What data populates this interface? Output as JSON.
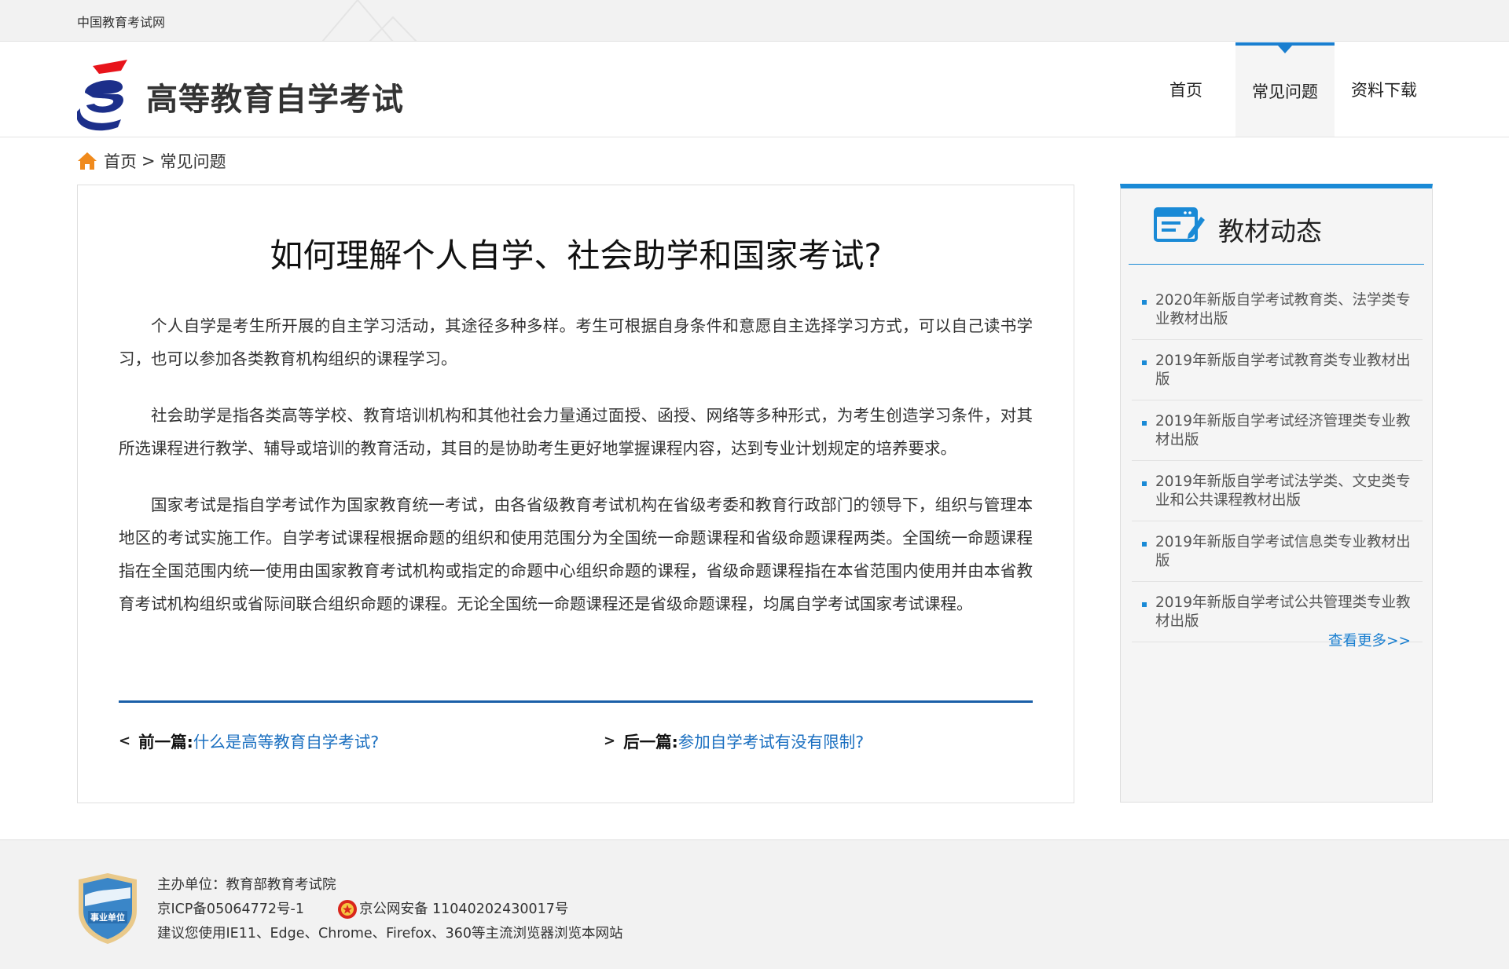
{
  "topbar": {
    "site_name": "中国教育考试网"
  },
  "header": {
    "title": "高等教育自学考试",
    "nav": [
      {
        "label": "首页",
        "active": false
      },
      {
        "label": "常见问题",
        "active": true
      },
      {
        "label": "资料下载",
        "active": false
      }
    ]
  },
  "breadcrumb": {
    "home": "首页",
    "separator": ">",
    "current": "常见问题"
  },
  "article": {
    "title": "如何理解个人自学、社会助学和国家考试?",
    "paragraphs": [
      "个人自学是考生所开展的自主学习活动，其途径多种多样。考生可根据自身条件和意愿自主选择学习方式，可以自己读书学习，也可以参加各类教育机构组织的课程学习。",
      "社会助学是指各类高等学校、教育培训机构和其他社会力量通过面授、函授、网络等多种形式，为考生创造学习条件，对其所选课程进行教学、辅导或培训的教育活动，其目的是协助考生更好地掌握课程内容，达到专业计划规定的培养要求。",
      "国家考试是指自学考试作为国家教育统一考试，由各省级教育考试机构在省级考委和教育行政部门的领导下，组织与管理本地区的考试实施工作。自学考试课程根据命题的组织和使用范围分为全国统一命题课程和省级命题课程两类。全国统一命题课程指在全国范围内统一使用由国家教育考试机构或指定的命题中心组织命题的课程，省级命题课程指在本省范围内使用并由本省教育考试机构组织或省际间联合组织命题的课程。无论全国统一命题课程还是省级命题课程，均属自学考试国家考试课程。"
    ],
    "prev": {
      "arrow": "<",
      "label": "前一篇:",
      "link": "什么是高等教育自学考试?"
    },
    "next": {
      "arrow": ">",
      "label": "后一篇:",
      "link": "参加自学考试有没有限制?"
    }
  },
  "sidebar": {
    "title": "教材动态",
    "items": [
      "2020年新版自学考试教育类、法学类专业教材出版",
      "2019年新版自学考试教育类专业教材出版",
      "2019年新版自学考试经济管理类专业教材出版",
      "2019年新版自学考试法学类、文史类专业和公共课程教材出版",
      "2019年新版自学考试信息类专业教材出版",
      "2019年新版自学考试公共管理类专业教材出版"
    ],
    "more": "查看更多>>"
  },
  "footer": {
    "sponsor": "主办单位：教育部教育考试院",
    "icp": "京ICP备05064772号-1",
    "police": "京公网安备 11040202430017号",
    "browser_tip": "建议您使用IE11、Edge、Chrome、Firefox、360等主流浏览器浏览本网站",
    "badge_text": "事业单位"
  },
  "colors": {
    "accent": "#1a8ad6",
    "link": "#1a6fc0",
    "divider": "#1a5fa8",
    "logo_red": "#e8141b",
    "logo_blue": "#1c2f8a"
  }
}
